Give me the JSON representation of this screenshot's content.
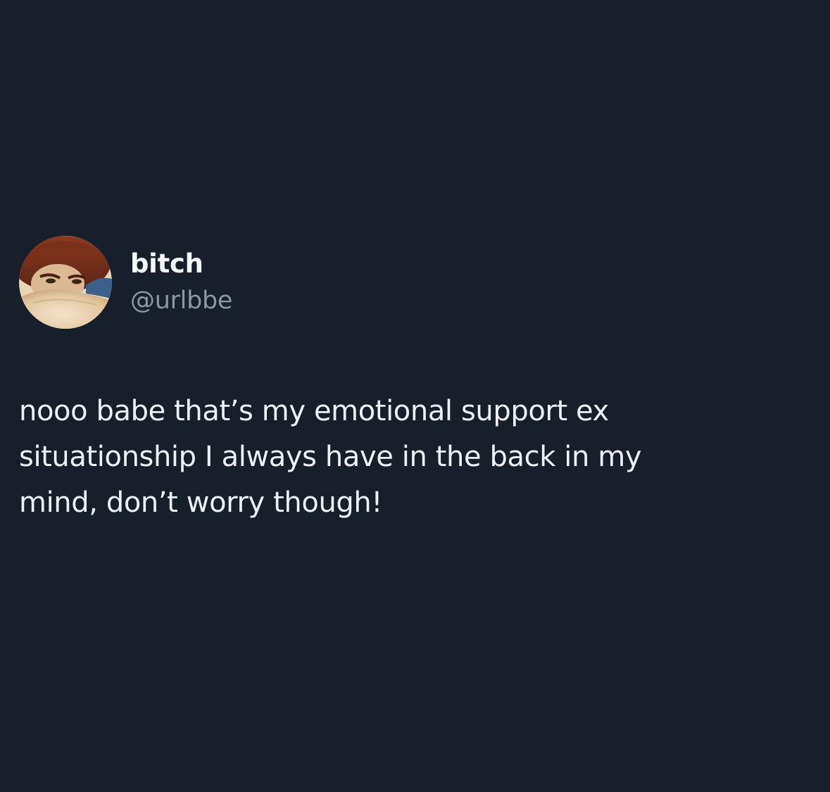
{
  "theme": {
    "background": "#161f2a",
    "text_primary": "#eef1f4",
    "text_secondary": "#8a97a4"
  },
  "author": {
    "display_name": "bitch",
    "handle": "@urlbbe",
    "avatar_icon": "profile-avatar"
  },
  "tweet": {
    "lines": [
      "nooo babe that’s my emotional support ex",
      "situationship I always have in the back in my",
      "mind, don’t worry though!"
    ]
  }
}
